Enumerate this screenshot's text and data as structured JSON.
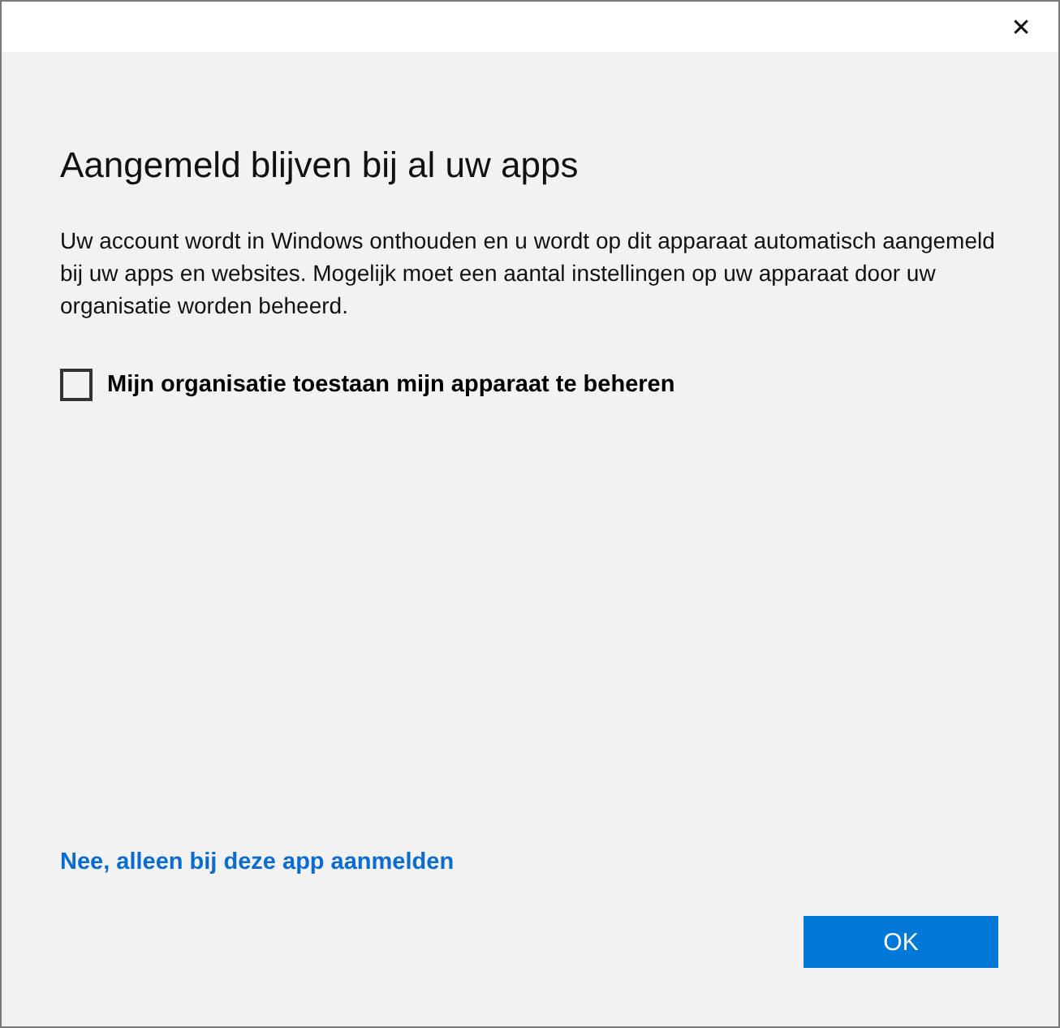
{
  "window": {
    "close_label": "✕"
  },
  "heading": "Aangemeld blijven bij al uw apps",
  "description": "Uw account wordt in Windows onthouden en u wordt op dit apparaat automatisch aangemeld bij uw apps en websites. Mogelijk moet een aantal instellingen op uw apparaat door uw organisatie worden beheerd.",
  "checkbox": {
    "label": "Mijn organisatie toestaan mijn apparaat te beheren",
    "checked": false
  },
  "link": "Nee, alleen bij deze app aanmelden",
  "buttons": [
    "OK"
  ]
}
